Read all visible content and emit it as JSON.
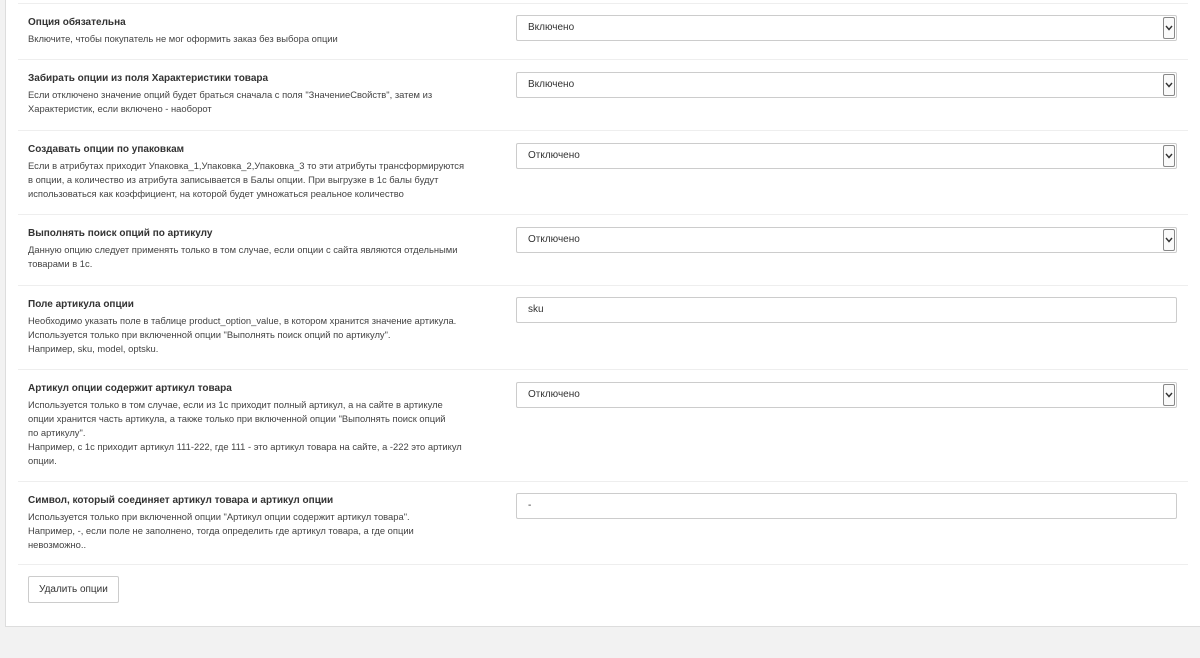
{
  "settings": [
    {
      "title": "Опция обязательна",
      "help": "Включите, чтобы покупатель не мог оформить заказ без выбора опции",
      "control": "select",
      "value": "Включено"
    },
    {
      "title": "Забирать опции из поля Характеристики товара",
      "help": "Если отключено значение опций будет браться сначала с поля \"ЗначениеСвойств\", затем из\nХарактеристик, если включено - наоборот",
      "control": "select",
      "value": "Включено"
    },
    {
      "title": "Создавать опции по упаковкам",
      "help": "Если в атрибутах приходит Упаковка_1,Упаковка_2,Упаковка_3 то эти атрибуты трансформируются\nв опции, а количество из атрибута записывается в Балы опции. При выгрузке в 1с балы будут\nиспользоваться как коэффициент, на которой будет умножаться реальное количество",
      "control": "select",
      "value": "Отключено"
    },
    {
      "title": "Выполнять поиск опций по артикулу",
      "help": "Данную опцию следует применять только в том случае, если опции с сайта являются отдельными\nтоварами в 1с.",
      "control": "select",
      "value": "Отключено"
    },
    {
      "title": "Поле артикула опции",
      "help": "Необходимо указать поле в таблице product_option_value, в котором хранится значение артикула.\nИспользуется только при включенной опции \"Выполнять поиск опций по артикулу\".\nНапример, sku, model, optsku.",
      "control": "input",
      "value": "sku"
    },
    {
      "title": "Артикул опции содержит артикул товара",
      "help": "Используется только в том случае, если из 1с приходит полный артикул, а на сайте в артикуле\nопции хранится часть артикула, а также только при включенной опции \"Выполнять поиск опций\nпо артикулу\".\nНапример, с 1с приходит артикул 111-222, где 111 - это артикул товара на сайте, а -222 это артикул\nопции.",
      "control": "select",
      "value": "Отключено"
    },
    {
      "title": "Символ, который соединяет артикул товара и артикул опции",
      "help": "Используется только при включенной опции \"Артикул опции содержит артикул товара\".\nНапример, -, если поле не заполнено, тогда определить где артикул товара, а где опции\nневозможно..",
      "control": "input",
      "value": "-"
    }
  ],
  "delete_button": "Удалить опции"
}
